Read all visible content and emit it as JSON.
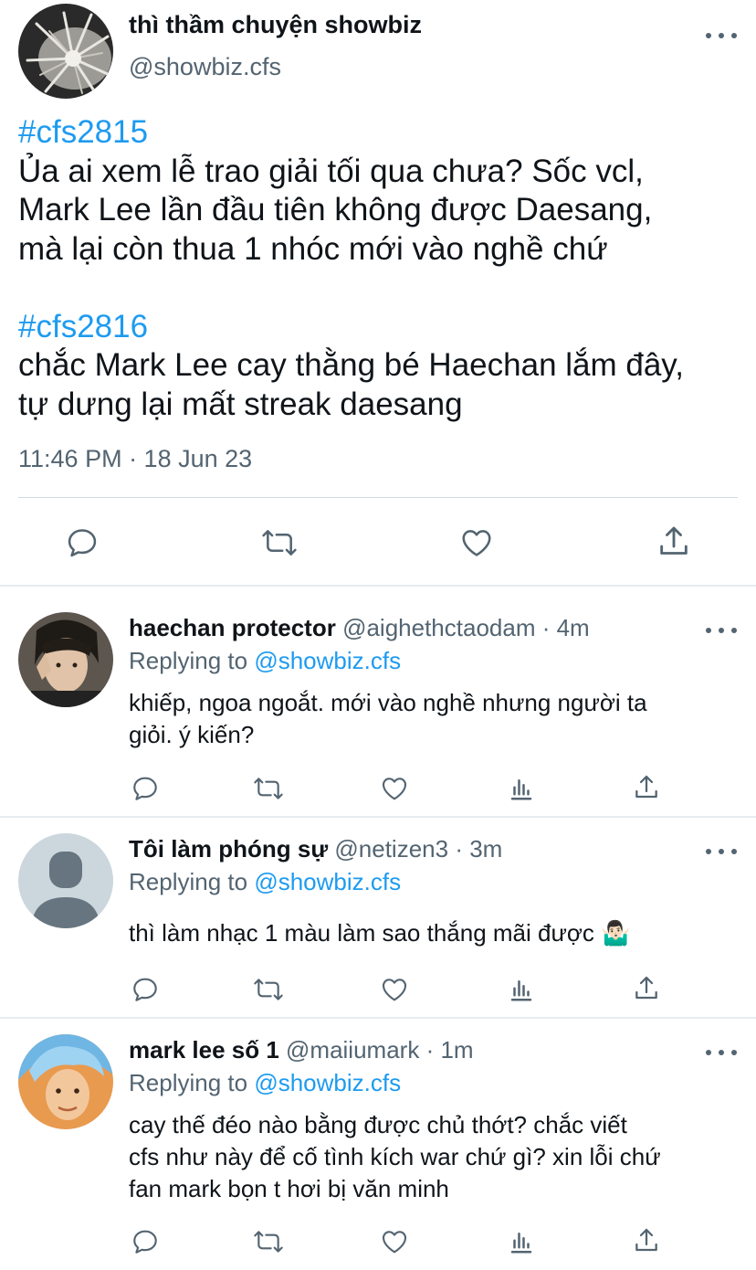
{
  "main_tweet": {
    "display_name": "thì thầm chuyện showbiz",
    "handle": "@showbiz.cfs",
    "posts": [
      {
        "hashtag": "#cfs2815",
        "text": "Ủa ai xem lễ trao giải tối qua chưa? Sốc vcl,\nMark Lee lần đầu tiên không được Daesang,\nmà lại còn thua 1 nhóc mới vào nghề chứ"
      },
      {
        "hashtag": "#cfs2816",
        "text": "chắc Mark Lee cay thằng bé Haechan lắm đây,\ntự dưng lại mất streak daesang"
      }
    ],
    "timestamp": "11:46 PM · 18 Jun 23",
    "actions": [
      "reply-icon",
      "retweet-icon",
      "like-icon",
      "share-icon"
    ]
  },
  "replies": [
    {
      "display_name": "haechan protector",
      "handle": "@aighethctaodam",
      "time": "· 4m",
      "replying_prefix": "Replying to",
      "replying_to": "@showbiz.cfs",
      "text": "khiếp, ngoa ngoắt. mới vào nghề nhưng người ta\ngiỏi. ý kiến?"
    },
    {
      "display_name": "Tôi làm phóng sự",
      "handle": "@netizen3",
      "time": "· 3m",
      "replying_prefix": "Replying to",
      "replying_to": "@showbiz.cfs",
      "text": "thì làm nhạc 1 màu làm sao thắng mãi được 🤷🏻‍♂️"
    },
    {
      "display_name": "mark lee số 1",
      "handle": "@maiiumark",
      "time": "· 1m",
      "replying_prefix": "Replying to",
      "replying_to": "@showbiz.cfs",
      "text": "cay thế đéo nào bằng được chủ thớt? chắc viết\ncfs như này để cố tình kích war chứ gì? xin lỗi chứ\nfan mark bọn t hơi bị văn minh"
    }
  ],
  "reply_actions": [
    "reply-icon",
    "retweet-icon",
    "like-icon",
    "analytics-icon",
    "share-icon"
  ],
  "colors": {
    "accent": "#1d9bf0",
    "secondary_text": "#536471",
    "primary_text": "#0f1419",
    "divider": "#cfd9de"
  }
}
